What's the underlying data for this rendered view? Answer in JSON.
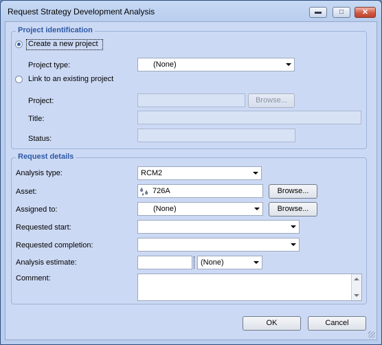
{
  "window": {
    "title": "Request Strategy Development Analysis"
  },
  "project_identification": {
    "group_title": "Project identification",
    "create_new_label": "Create a new project",
    "project_type_label": "Project type:",
    "project_type_value": "(None)",
    "link_existing_label": "Link to an existing project",
    "project_label": "Project:",
    "browse_label": "Browse...",
    "title_label": "Title:",
    "status_label": "Status:"
  },
  "request_details": {
    "group_title": "Request details",
    "analysis_type_label": "Analysis type:",
    "analysis_type_value": "RCM2",
    "asset_label": "Asset:",
    "asset_value": "726A",
    "asset_browse_label": "Browse...",
    "assigned_to_label": "Assigned to:",
    "assigned_to_value": "(None)",
    "assigned_browse_label": "Browse...",
    "requested_start_label": "Requested start:",
    "requested_completion_label": "Requested completion:",
    "analysis_estimate_label": "Analysis estimate:",
    "estimate_unit_value": "(None)",
    "comment_label": "Comment:"
  },
  "footer": {
    "ok_label": "OK",
    "cancel_label": "Cancel"
  }
}
